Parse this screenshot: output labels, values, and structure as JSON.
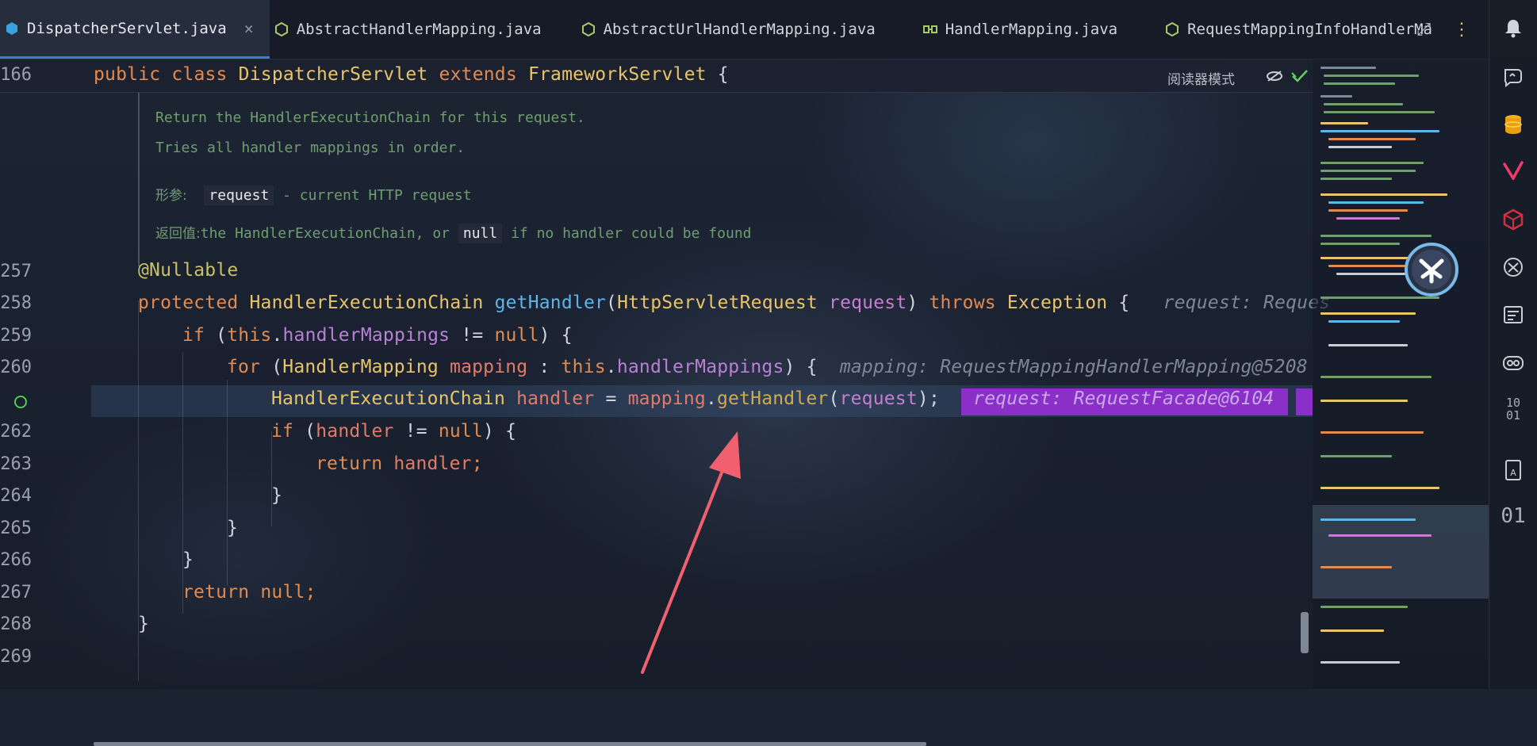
{
  "tabs": [
    {
      "label": "DispatcherServlet.java",
      "icon": "java-class-icon",
      "active": true
    },
    {
      "label": "AbstractHandlerMapping.java",
      "icon": "abstract-class-icon",
      "active": false
    },
    {
      "label": "AbstractUrlHandlerMapping.java",
      "icon": "abstract-class-icon",
      "active": false
    },
    {
      "label": "HandlerMapping.java",
      "icon": "interface-icon",
      "active": false
    },
    {
      "label": "RequestMappingInfoHandlerMa",
      "icon": "abstract-class-icon",
      "active": false
    }
  ],
  "tab_close_glyph": "×",
  "sticky": {
    "line": "166",
    "public": "public",
    "class": "class",
    "name": "DispatcherServlet",
    "extends": "extends",
    "super": "FrameworkServlet",
    "brace": "{",
    "reader_mode": "阅读器模式"
  },
  "doc": {
    "line1": "Return the HandlerExecutionChain for this request.",
    "line2": "Tries all handler mappings in order.",
    "param_label": "形参:",
    "param_name": "request",
    "param_desc": "- current HTTP request",
    "return_label": "返回值:",
    "return_a": "the HandlerExecutionChain, or",
    "return_null": "null",
    "return_b": "if no handler could be found"
  },
  "code": {
    "l257": {
      "num": "257",
      "ann": "@Nullable"
    },
    "l258": {
      "num": "258",
      "kw": "protected",
      "ret": "HandlerExecutionChain",
      "fn": "getHandler",
      "open": "(",
      "ptype": "HttpServletRequest",
      "pname": "request",
      "close": ")",
      "throws": "throws",
      "ex": "Exception",
      "brace": "{",
      "hint": "request: Reques"
    },
    "l259": {
      "num": "259",
      "if": "if",
      "open": "(",
      "this": "this",
      "dot": ".",
      "field": "handlerMappings",
      "op": "!=",
      "null": "null",
      "close": ")",
      "brace": "{"
    },
    "l260": {
      "num": "260",
      "for": "for",
      "open": "(",
      "type": "HandlerMapping",
      "var": "mapping",
      "colon": ":",
      "this": "this",
      "dot": ".",
      "field": "handlerMappings",
      "close": ")",
      "brace": "{",
      "hint": "mapping: RequestMappingHandlerMapping@5208"
    },
    "l261": {
      "type": "HandlerExecutionChain",
      "var": "handler",
      "eq": "=",
      "obj": "mapping",
      "dot": ".",
      "call": "getHandler",
      "open": "(",
      "arg": "request",
      "close": ");",
      "hint": "request: RequestFacade@6104"
    },
    "l262": {
      "num": "262",
      "if": "if",
      "open": "(",
      "var": "handler",
      "op": "!=",
      "null": "null",
      "close": ")",
      "brace": "{"
    },
    "l263": {
      "num": "263",
      "ret": "return",
      "var": "handler",
      "semi": ";"
    },
    "l264": {
      "num": "264",
      "brace": "}"
    },
    "l265": {
      "num": "265",
      "brace": "}"
    },
    "l266": {
      "num": "266",
      "brace": "}"
    },
    "l267": {
      "num": "267",
      "ret": "return",
      "null": "null",
      "semi": ";"
    },
    "l268": {
      "num": "268",
      "brace": "}"
    },
    "l269": {
      "num": "269"
    }
  },
  "toolstrip": {
    "icons": [
      "notifications-bell-icon",
      "ai-chat-icon",
      "database-icon",
      "vue-icon",
      "cube-icon",
      "translate-icon",
      "terminal-log-icon",
      "copilot-icon",
      "binary-icon",
      "dictionary-icon"
    ],
    "binary_label": "10\n01",
    "num_label": "01"
  },
  "colors": {
    "keyword": "#e08b52",
    "type": "#e8c46a",
    "function": "#5fb4ea",
    "parameter": "#c77dd1",
    "doc_comment": "#6f9e6f",
    "inlay_highlight": "#8a2fc8",
    "arrow": "#f0606e"
  }
}
